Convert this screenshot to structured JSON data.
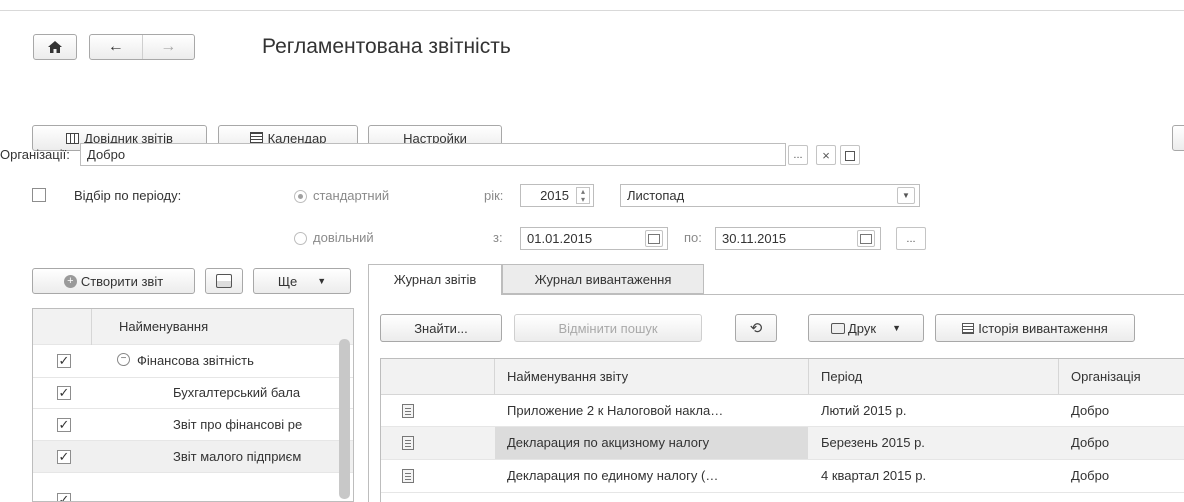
{
  "header": {
    "title": "Регламентована звітність"
  },
  "toolbar": {
    "directory_label": "Довідник звітів",
    "calendar_label": "Календар",
    "settings_label": "Настройки"
  },
  "organization": {
    "label": "Організації:",
    "value": "Добро",
    "choose_label": "...",
    "clear_label": "×"
  },
  "period": {
    "filter_label": "Відбір по періоду:",
    "standard_label": "стандартний",
    "year_label": "рік:",
    "year_value": "2015",
    "month_value": "Листопад",
    "custom_label": "довільний",
    "from_label": "з:",
    "from_value": "01.01.2015",
    "to_label": "по:",
    "to_value": "30.11.2015",
    "more_label": "..."
  },
  "left_panel": {
    "create_label": "Створити звіт",
    "more_label": "Ще",
    "column_header": "Найменування",
    "rows": [
      {
        "label": "Фінансова звітність",
        "checked": true
      },
      {
        "label": "Бухгалтерський бала",
        "checked": true
      },
      {
        "label": "Звіт про фінансові ре",
        "checked": true
      },
      {
        "label": "Звіт малого підприєм",
        "checked": true
      }
    ]
  },
  "tabs": [
    {
      "label": "Журнал звітів",
      "active": true
    },
    {
      "label": "Журнал вивантаження",
      "active": false
    }
  ],
  "journal_toolbar": {
    "find_label": "Знайти...",
    "cancel_search_label": "Відмінити пошук",
    "print_label": "Друк",
    "history_label": "Історія вивантаження"
  },
  "journal_table": {
    "columns": [
      "Найменування звіту",
      "Період",
      "Організація"
    ],
    "rows": [
      {
        "name": "Приложение 2 к Налоговой накла…",
        "period": "Лютий 2015 р.",
        "org": "Добро"
      },
      {
        "name": "Декларация по акцизному налогу",
        "period": "Березень 2015 р.",
        "org": "Добро"
      },
      {
        "name": "Декларация по единому налогу (…",
        "period": "4 квартал 2015 р.",
        "org": "Добро"
      }
    ]
  }
}
